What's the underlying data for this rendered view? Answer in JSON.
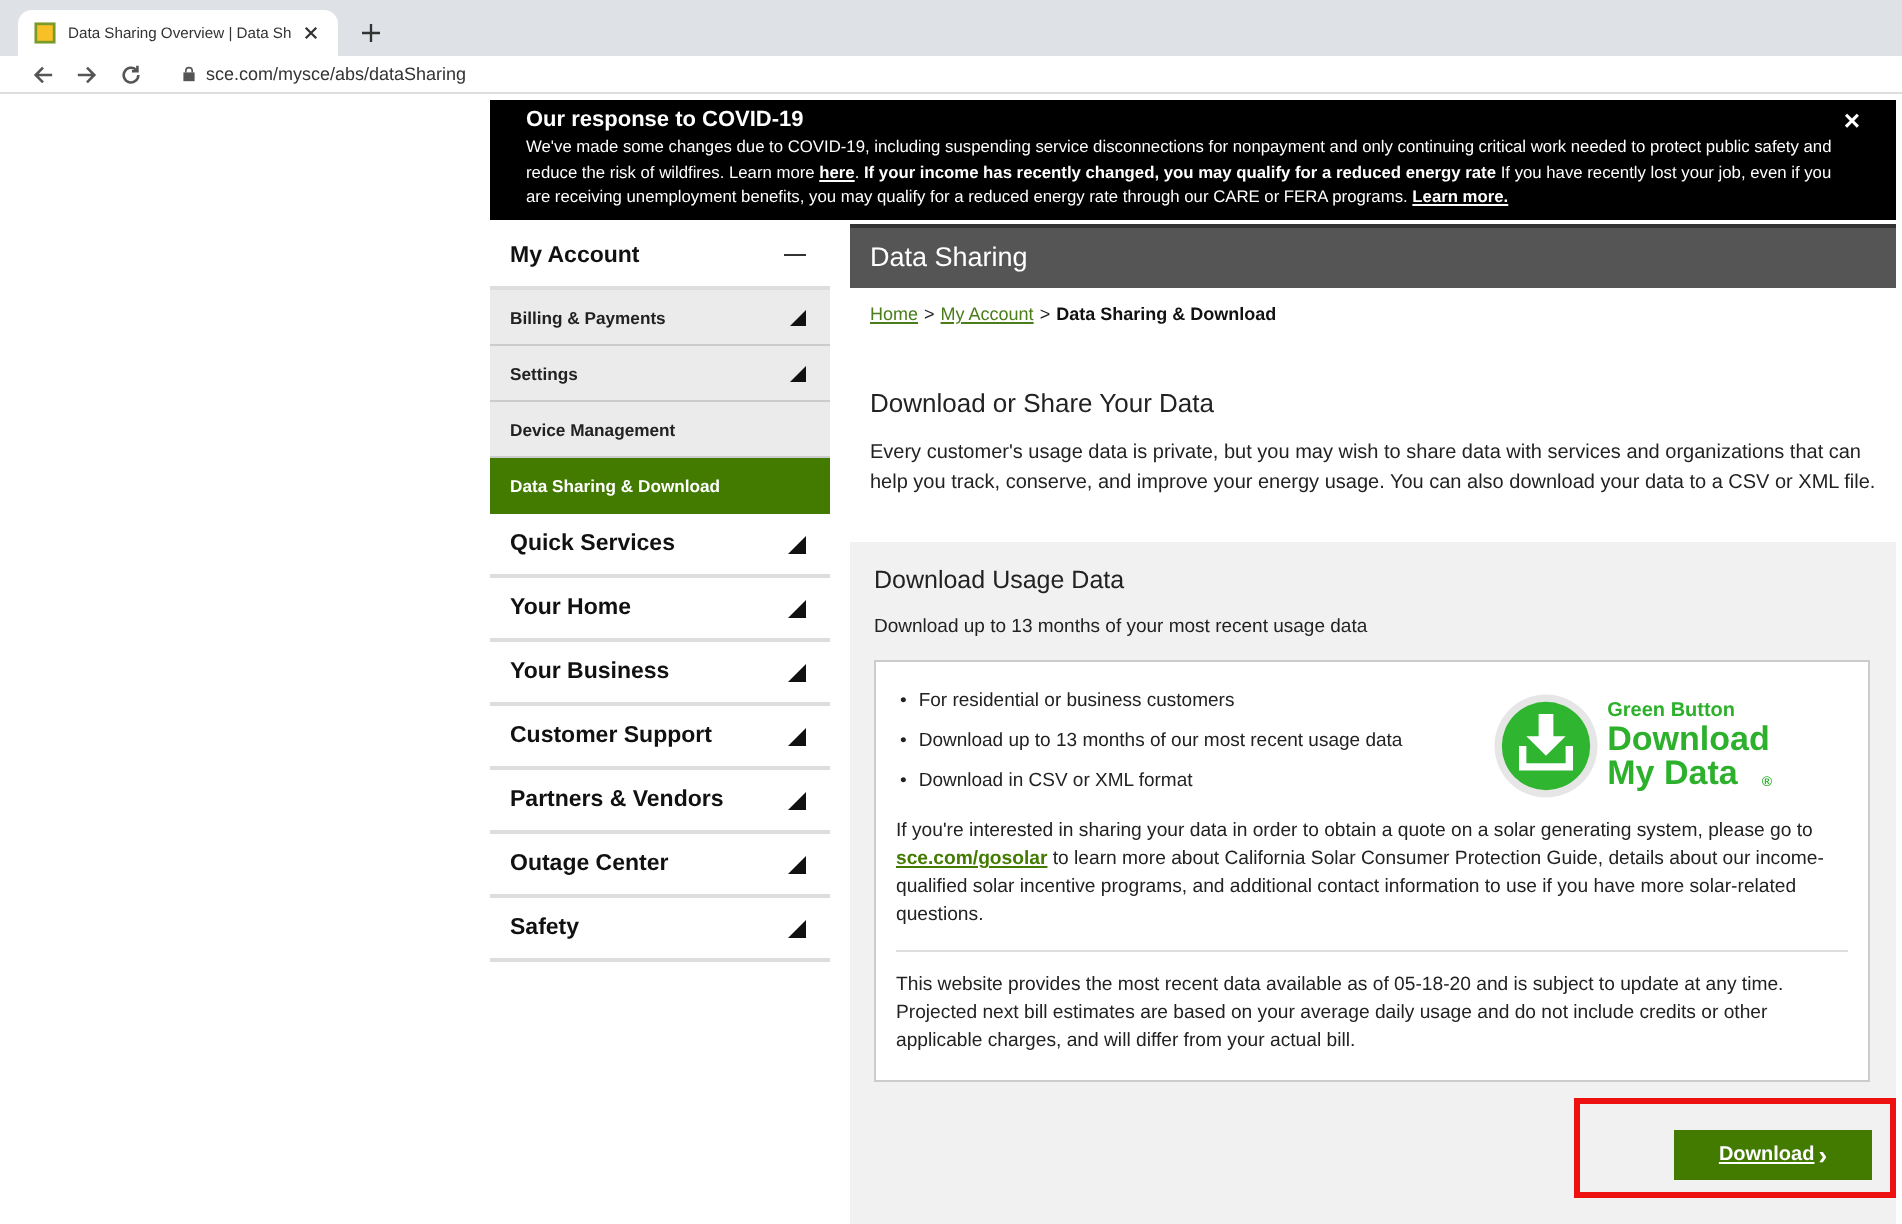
{
  "browser": {
    "tab_title": "Data Sharing Overview | Data Sh",
    "url": "sce.com/mysce/abs/dataSharing"
  },
  "banner": {
    "title": "Our response to COVID-19",
    "close": "×",
    "body": [
      {
        "kind": "text",
        "text": "We've made some changes due to COVID-19, including suspending service disconnections for nonpayment and only continuing critical work needed to protect public safety and reduce the risk of wildfires.   Learn more "
      },
      {
        "kind": "link",
        "text": "here"
      },
      {
        "kind": "text",
        "text": ". **If your income has recently changed, you may qualify for a reduced energy rate** If you have recently lost your job, even if you are receiving unemployment benefits, you may qualify for a reduced energy rate through our CARE or FERA programs. "
      },
      {
        "kind": "link",
        "text": "Learn more."
      }
    ]
  },
  "sidebar": {
    "items": [
      {
        "label": "My Account",
        "expanded": true,
        "children": [
          {
            "label": "Billing & Payments",
            "expandable": true,
            "selected": false
          },
          {
            "label": "Settings",
            "expandable": true,
            "selected": false
          },
          {
            "label": "Device Management",
            "expandable": false,
            "selected": false
          },
          {
            "label": "Data Sharing & Download",
            "expandable": false,
            "selected": true
          }
        ]
      },
      {
        "label": "Quick Services",
        "expanded": false
      },
      {
        "label": "Your Home",
        "expanded": false
      },
      {
        "label": "Your Business",
        "expanded": false
      },
      {
        "label": "Customer Support",
        "expanded": false
      },
      {
        "label": "Partners & Vendors",
        "expanded": false
      },
      {
        "label": "Outage Center",
        "expanded": false
      },
      {
        "label": "Safety",
        "expanded": false
      }
    ]
  },
  "main": {
    "header": "Data Sharing",
    "breadcrumb": [
      {
        "kind": "link",
        "text": "Home"
      },
      {
        "kind": "sep",
        "text": ">"
      },
      {
        "kind": "link",
        "text": "My Account"
      },
      {
        "kind": "sep",
        "text": ">"
      },
      {
        "kind": "current",
        "text": "Data Sharing & Download"
      }
    ],
    "heading": "Download or Share Your Data",
    "intro": "Every customer's usage data is private, but you may wish to share data with services and organizations that can help you track, conserve, and improve your energy usage. You can also download your data to a CSV or XML file.",
    "panel": {
      "title": "Download Usage Data",
      "subtitle": "Download up to 13 months of your most recent usage data",
      "bullet_marker": "•",
      "bullets": [
        "For residential or business customers",
        "Download up to 13 months of our most recent usage data",
        "Download in CSV or XML format"
      ],
      "logo": {
        "line_1": "Green Button",
        "line_2": "Download",
        "line_3": "My Data",
        "mark": "®"
      },
      "solar": [
        {
          "kind": "text",
          "text": "If you're interested in sharing your data in order to obtain a quote on a solar generating system, please go to "
        },
        {
          "kind": "link",
          "text": "sce.com/gosolar"
        },
        {
          "kind": "text",
          "text": " to learn more about California Solar Consumer Protection Guide, details about our income-qualified solar incentive programs, and additional contact information to use if you have more solar-related questions."
        }
      ],
      "note": "This website provides the most recent data available as of 05-18-20 and is subject to update at any time. Projected next bill estimates are based on your average daily usage and do not include credits or other applicable charges, and will differ from your actual bill.",
      "button": {
        "label": "Download",
        "arrow": "›",
        "highlighted": true
      }
    }
  }
}
